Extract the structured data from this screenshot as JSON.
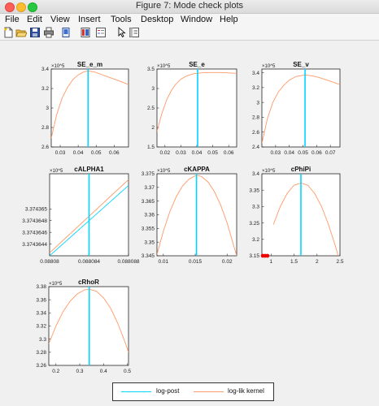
{
  "window": {
    "title": "Figure 7: Mode check plots"
  },
  "menubar": {
    "items": [
      "File",
      "Edit",
      "View",
      "Insert",
      "Tools",
      "Desktop",
      "Window",
      "Help"
    ]
  },
  "toolbar": {
    "buttons": [
      "new-figure-icon",
      "open-file-icon",
      "save-icon",
      "print-icon",
      "link-plot-icon",
      "insert-colorbar-icon",
      "insert-legend-icon",
      "edit-plot-arrow-icon",
      "property-inspector-icon"
    ]
  },
  "colors": {
    "log_post": "#00d5ff",
    "log_lik_kernel": "#ff9966",
    "mode_marker": "#ee0000"
  },
  "legend": {
    "log_post": "log-post",
    "log_lik_kernel": "log-lik kernel"
  },
  "chart_data": [
    {
      "type": "line",
      "title": "SE_e_m",
      "exponent": "×10^5",
      "xlim": [
        0.025,
        0.068
      ],
      "ylim": [
        2.6,
        3.4
      ],
      "xticks": [
        0.03,
        0.04,
        0.05,
        0.06
      ],
      "xtick_labels": [
        "0.03",
        "0.04",
        "0.05",
        "0.06"
      ],
      "yticks": [
        2.6,
        2.8,
        3.0,
        3.2,
        3.4
      ],
      "ytick_labels": [
        "2.6",
        "2.8",
        "3",
        "3.2",
        "3.4"
      ],
      "mode": 0.0455,
      "series": [
        {
          "name": "log-lik kernel",
          "x": [
            0.025,
            0.028,
            0.031,
            0.034,
            0.037,
            0.04,
            0.043,
            0.0455,
            0.049,
            0.052,
            0.055,
            0.058,
            0.061,
            0.064,
            0.068
          ],
          "y": [
            2.69,
            2.93,
            3.1,
            3.21,
            3.29,
            3.34,
            3.37,
            3.38,
            3.37,
            3.35,
            3.33,
            3.31,
            3.29,
            3.27,
            3.24
          ]
        }
      ]
    },
    {
      "type": "line",
      "title": "SE_e",
      "exponent": "×10^5",
      "xlim": [
        0.015,
        0.065
      ],
      "ylim": [
        1.5,
        3.5
      ],
      "xticks": [
        0.02,
        0.03,
        0.04,
        0.05,
        0.06
      ],
      "xtick_labels": [
        "0.02",
        "0.03",
        "0.04",
        "0.05",
        "0.06"
      ],
      "yticks": [
        1.5,
        2.0,
        2.5,
        3.0,
        3.5
      ],
      "ytick_labels": [
        "1.5",
        "2",
        "2.5",
        "3",
        "3.5"
      ],
      "mode": 0.0405,
      "series": [
        {
          "name": "log-lik kernel",
          "x": [
            0.015,
            0.018,
            0.021,
            0.024,
            0.027,
            0.03,
            0.034,
            0.038,
            0.0405,
            0.045,
            0.05,
            0.055,
            0.06,
            0.065
          ],
          "y": [
            1.9,
            2.35,
            2.7,
            2.95,
            3.12,
            3.24,
            3.33,
            3.38,
            3.39,
            3.41,
            3.41,
            3.41,
            3.4,
            3.39
          ]
        }
      ]
    },
    {
      "type": "line",
      "title": "SE_v",
      "exponent": "×10^5",
      "xlim": [
        0.02,
        0.077
      ],
      "ylim": [
        2.4,
        3.45
      ],
      "xticks": [
        0.03,
        0.04,
        0.05,
        0.06,
        0.07
      ],
      "xtick_labels": [
        "0.03",
        "0.04",
        "0.05",
        "0.06",
        "0.07"
      ],
      "yticks": [
        2.4,
        2.6,
        2.8,
        3.0,
        3.2,
        3.4
      ],
      "ytick_labels": [
        "2.4",
        "2.6",
        "2.8",
        "3",
        "3.2",
        "3.4"
      ],
      "mode": 0.0515,
      "series": [
        {
          "name": "log-lik kernel",
          "x": [
            0.02,
            0.024,
            0.028,
            0.032,
            0.036,
            0.04,
            0.045,
            0.0515,
            0.056,
            0.061,
            0.066,
            0.071,
            0.077
          ],
          "y": [
            2.45,
            2.78,
            3.0,
            3.14,
            3.23,
            3.3,
            3.35,
            3.37,
            3.36,
            3.34,
            3.31,
            3.28,
            3.24
          ]
        }
      ]
    },
    {
      "type": "line",
      "title": "cALPHA1",
      "exponent": "×10^5",
      "xlim": [
        0.08808,
        0.088088
      ],
      "ylim": [
        3.3743642,
        3.3743656
      ],
      "xticks": [
        0.08808,
        0.088084,
        0.088088
      ],
      "xtick_labels": [
        "0.08808",
        "0.088084",
        "0.088088"
      ],
      "yticks": [
        3.3743644,
        3.3743646,
        3.3743648,
        3.374365
      ],
      "ytick_labels": [
        "3.3743644",
        "3.3743646",
        "3.3743648",
        "3.374365"
      ],
      "mode": 0.088084,
      "series": [
        {
          "name": "log-post",
          "x": [
            0.08808,
            0.088088
          ],
          "y": [
            3.3743642,
            3.3743654
          ]
        },
        {
          "name": "log-lik kernel",
          "x": [
            0.08808,
            0.088088
          ],
          "y": [
            3.37436425,
            3.3743655
          ]
        }
      ]
    },
    {
      "type": "line",
      "title": "cKAPPA",
      "exponent": "×10^5",
      "xlim": [
        0.009,
        0.0215
      ],
      "ylim": [
        3.345,
        3.375
      ],
      "xticks": [
        0.01,
        0.015,
        0.02
      ],
      "xtick_labels": [
        "0.01",
        "0.015",
        "0.02"
      ],
      "yticks": [
        3.345,
        3.35,
        3.355,
        3.36,
        3.365,
        3.37,
        3.375
      ],
      "ytick_labels": [
        "3.345",
        "3.35",
        "3.355",
        "3.36",
        "3.365",
        "3.37",
        "3.375"
      ],
      "mode": 0.0152,
      "series": [
        {
          "name": "log-lik kernel",
          "x": [
            0.009,
            0.01,
            0.011,
            0.012,
            0.013,
            0.014,
            0.0152,
            0.016,
            0.017,
            0.018,
            0.019,
            0.02,
            0.0215
          ],
          "y": [
            3.3455,
            3.354,
            3.361,
            3.3665,
            3.3705,
            3.373,
            3.3745,
            3.374,
            3.372,
            3.3685,
            3.3635,
            3.357,
            3.345
          ]
        }
      ]
    },
    {
      "type": "line",
      "title": "cPhiPi",
      "exponent": "×10^5",
      "xlim": [
        0.8,
        2.5
      ],
      "ylim": [
        3.15,
        3.4
      ],
      "xticks": [
        1.0,
        1.5,
        2.0,
        2.5
      ],
      "xtick_labels": [
        "1",
        "1.5",
        "2",
        "2.5"
      ],
      "yticks": [
        3.15,
        3.2,
        3.25,
        3.3,
        3.35,
        3.4
      ],
      "ytick_labels": [
        "3.15",
        "3.2",
        "3.25",
        "3.3",
        "3.35",
        "3.4"
      ],
      "mode": 1.65,
      "series": [
        {
          "name": "log-lik kernel",
          "x": [
            1.05,
            1.2,
            1.35,
            1.5,
            1.65,
            1.8,
            1.95,
            2.1,
            2.25,
            2.4,
            2.5
          ],
          "y": [
            3.245,
            3.3,
            3.34,
            3.365,
            3.372,
            3.365,
            3.34,
            3.3,
            3.245,
            3.18,
            3.13
          ]
        }
      ],
      "markers": [
        {
          "x": 0.82,
          "y": 3.15
        },
        {
          "x": 0.87,
          "y": 3.15
        },
        {
          "x": 0.92,
          "y": 3.15
        }
      ]
    },
    {
      "type": "line",
      "title": "cRhoR",
      "exponent": "×10^5",
      "xlim": [
        0.17,
        0.505
      ],
      "ylim": [
        3.26,
        3.38
      ],
      "xticks": [
        0.2,
        0.3,
        0.4,
        0.5
      ],
      "xtick_labels": [
        "0.2",
        "0.3",
        "0.4",
        "0.5"
      ],
      "yticks": [
        3.26,
        3.28,
        3.3,
        3.32,
        3.34,
        3.36,
        3.38
      ],
      "ytick_labels": [
        "3.26",
        "3.28",
        "3.3",
        "3.32",
        "3.34",
        "3.36",
        "3.38"
      ],
      "mode": 0.34,
      "series": [
        {
          "name": "log-lik kernel",
          "x": [
            0.17,
            0.2,
            0.23,
            0.26,
            0.29,
            0.32,
            0.34,
            0.37,
            0.4,
            0.43,
            0.46,
            0.49,
            0.505
          ],
          "y": [
            3.293,
            3.32,
            3.342,
            3.358,
            3.369,
            3.375,
            3.376,
            3.373,
            3.363,
            3.347,
            3.324,
            3.296,
            3.28
          ]
        }
      ]
    }
  ]
}
